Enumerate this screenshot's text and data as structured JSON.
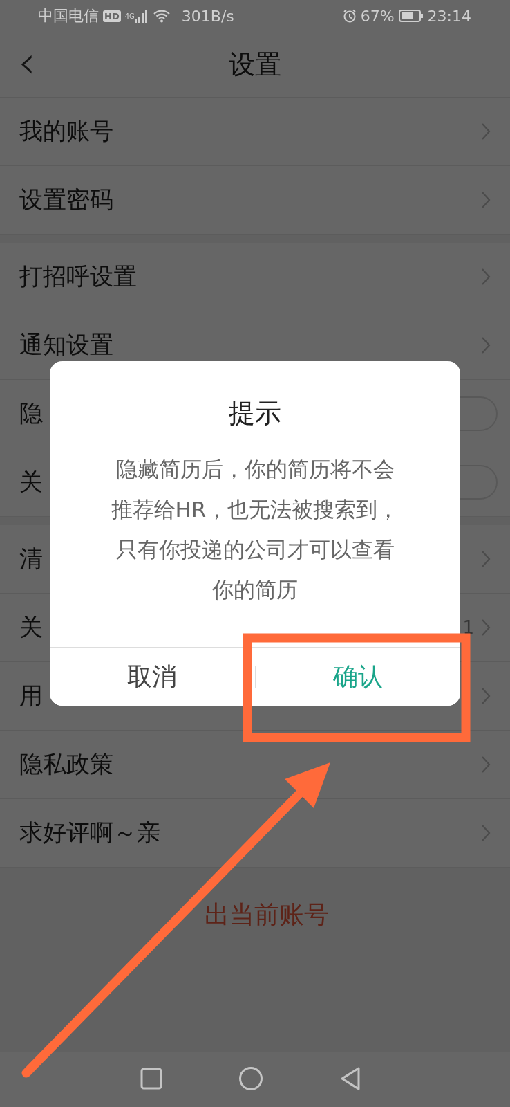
{
  "status_bar": {
    "carrier": "中国电信",
    "hd_badge": "HD",
    "network": "4G",
    "speed": "301B/s",
    "battery": "67%",
    "time": "23:14"
  },
  "header": {
    "back": "‹",
    "title": "设置"
  },
  "sections": [
    {
      "items": [
        {
          "label": "我的账号",
          "kind": "link"
        },
        {
          "label": "设置密码",
          "kind": "link"
        }
      ]
    },
    {
      "items": [
        {
          "label": "打招呼设置",
          "kind": "link"
        },
        {
          "label": "通知设置",
          "kind": "link"
        },
        {
          "label": "隐",
          "kind": "toggle",
          "on": false
        },
        {
          "label": "关",
          "kind": "toggle",
          "on": false
        }
      ]
    },
    {
      "items": [
        {
          "label": "清",
          "kind": "link"
        },
        {
          "label": "关",
          "kind": "link",
          "value": "1"
        },
        {
          "label": "用",
          "kind": "link"
        },
        {
          "label": "隐私政策",
          "kind": "link"
        },
        {
          "label": "求好评啊～亲",
          "kind": "link"
        }
      ]
    }
  ],
  "logout": "出当前账号",
  "dialog": {
    "title": "提示",
    "message_lines": [
      "隐藏简历后，你的简历将不会",
      "推荐给HR，也无法被搜索到，",
      "只有你投递的公司才可以查看",
      "你的简历"
    ],
    "buttons": [
      {
        "label": "取消",
        "kind": "cancel"
      },
      {
        "label": "确认",
        "kind": "confirm"
      }
    ]
  }
}
